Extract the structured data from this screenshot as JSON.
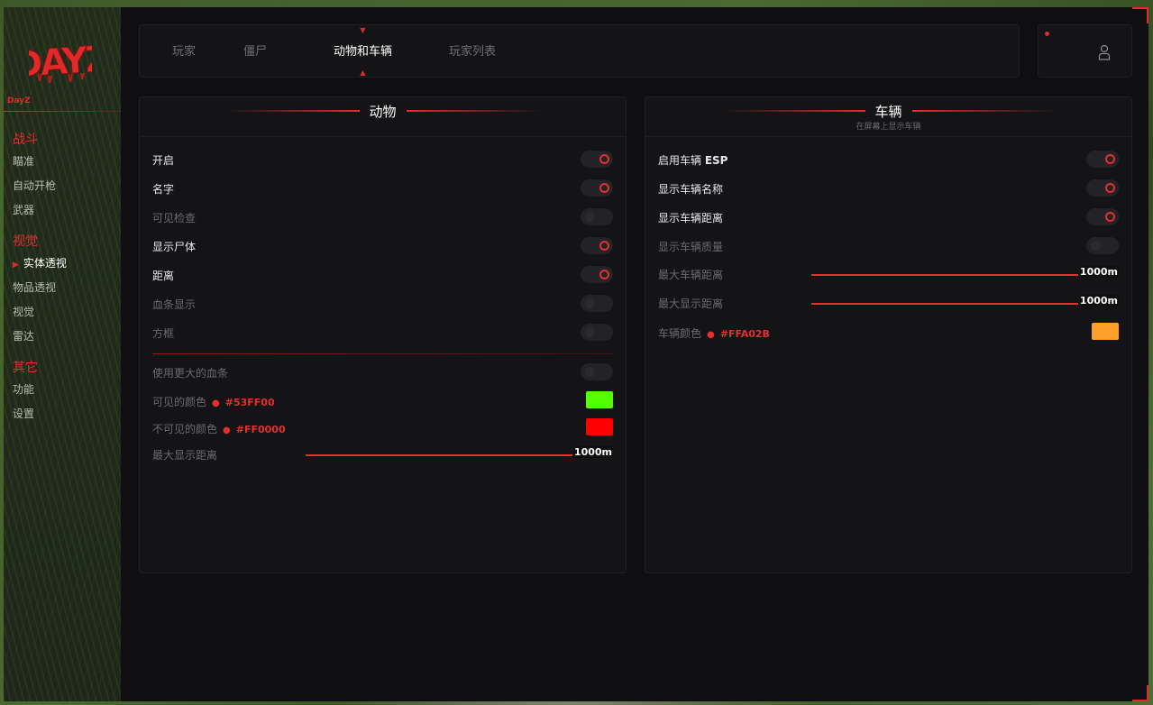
{
  "app": {
    "logo_text": "DAYZ",
    "logo_sub": "DayZ"
  },
  "colors": {
    "accent": "#e02a2a",
    "panel": "#141416",
    "window": "#0f0f11"
  },
  "sidebar": {
    "categories": [
      {
        "label": "战斗",
        "items": [
          {
            "label": "瞄准"
          },
          {
            "label": "自动开枪"
          },
          {
            "label": "武器"
          }
        ]
      },
      {
        "label": "视觉",
        "items": [
          {
            "label": "实体透视",
            "active": true
          },
          {
            "label": "物品透视"
          },
          {
            "label": "视觉"
          },
          {
            "label": "雷达"
          }
        ]
      },
      {
        "label": "其它",
        "items": [
          {
            "label": "功能"
          },
          {
            "label": "设置"
          }
        ]
      }
    ]
  },
  "tabs": [
    {
      "label": "玩家"
    },
    {
      "label": "僵尸"
    },
    {
      "label": "动物和车辆",
      "active": true
    },
    {
      "label": "玩家列表"
    }
  ],
  "user": {
    "icon": "user-icon"
  },
  "animals": {
    "title": "动物",
    "enable": {
      "label": "开启",
      "on": true
    },
    "name": {
      "label": "名字",
      "on": true
    },
    "visible_check": {
      "label": "可见检查",
      "on": false
    },
    "show_corpse": {
      "label": "显示尸体",
      "on": true
    },
    "distance": {
      "label": "距离",
      "on": true
    },
    "health_bar": {
      "label": "血条显示",
      "on": false
    },
    "box": {
      "label": "方框",
      "on": false
    },
    "bigger_health": {
      "label": "使用更大的血条",
      "on": false
    },
    "visible_color": {
      "label": "可见的颜色",
      "hex": "#53FF00",
      "color": "#53ff00"
    },
    "invisible_color": {
      "label": "不可见的颜色",
      "hex": "#FF0000",
      "color": "#ff0000"
    },
    "max_distance": {
      "label": "最大显示距离",
      "value": "1000m",
      "fraction": 1.0
    }
  },
  "vehicles": {
    "title": "车辆",
    "subtitle": "在屏幕上显示车辆",
    "enable_esp": {
      "label": "启用车辆",
      "label_bold": "ESP",
      "on": true
    },
    "show_name": {
      "label": "显示车辆名称",
      "on": true
    },
    "show_distance": {
      "label": "显示车辆距离",
      "on": true
    },
    "show_quality": {
      "label": "显示车辆质量",
      "on": false
    },
    "max_vehicle_distance": {
      "label": "最大车辆距离",
      "value": "1000m",
      "fraction": 1.0
    },
    "max_display_distance": {
      "label": "最大显示距离",
      "value": "1000m",
      "fraction": 1.0
    },
    "vehicle_color": {
      "label": "车辆颜色",
      "hex": "#FFA02B",
      "color": "#ffa02b"
    }
  }
}
